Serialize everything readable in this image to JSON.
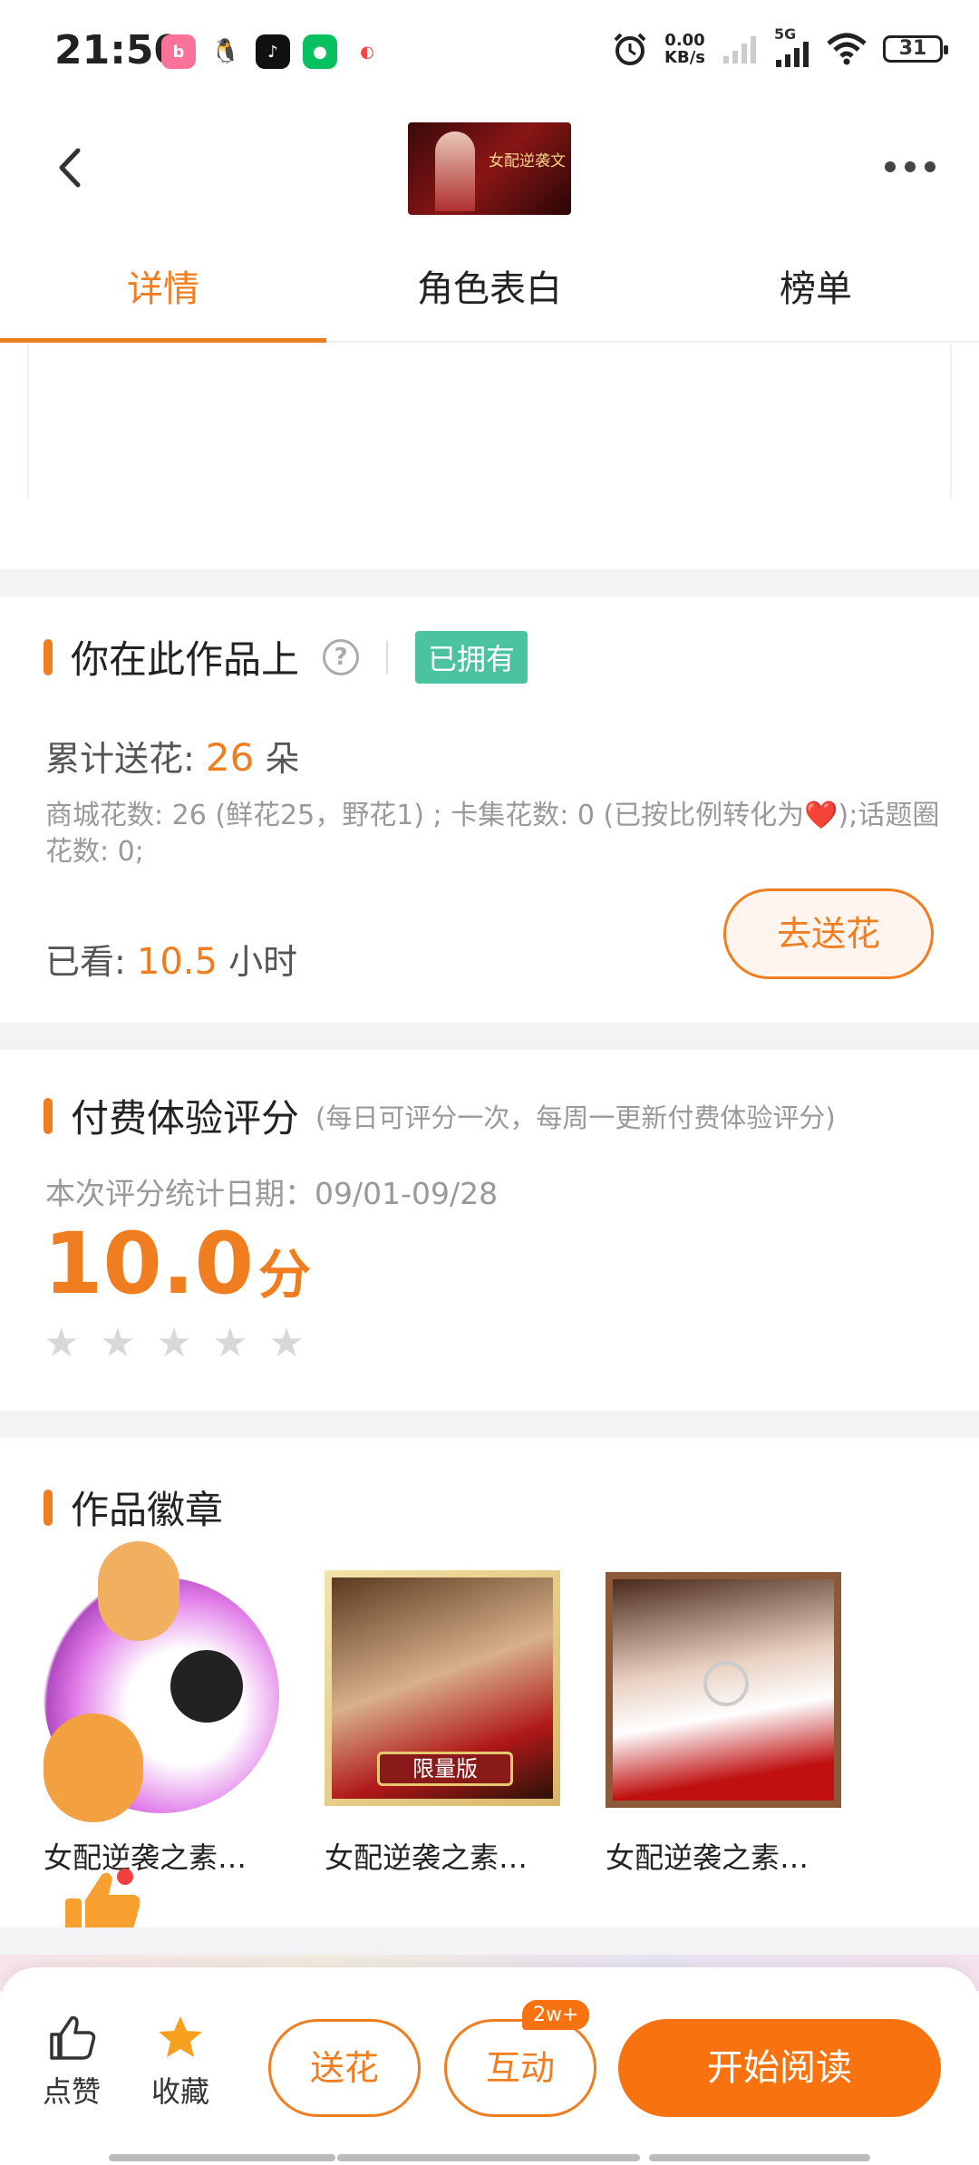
{
  "status_bar": {
    "time": "21:50",
    "net_speed_value": "0.00",
    "net_speed_unit": "KB/s",
    "signal_label": "5G",
    "battery": "31"
  },
  "nav": {
    "cover_title": "女配逆袭文"
  },
  "tabs": [
    {
      "label": "详情",
      "active": true
    },
    {
      "label": "角色表白",
      "active": false
    },
    {
      "label": "榜单",
      "active": false
    }
  ],
  "ownership": {
    "title": "你在此作品上",
    "help_symbol": "?",
    "owned_badge": "已拥有",
    "flowers_label": "累计送花:",
    "flowers_value": "26",
    "flowers_unit": "朵",
    "flowers_detail": "商城花数: 26 (鲜花25，野花1) ; 卡集花数: 0 (已按比例转化为❤️);话题圈花数: 0;",
    "watched_label": "已看:",
    "watched_value": "10.5",
    "watched_unit": "小时",
    "send_flower_button": "去送花"
  },
  "rating": {
    "title": "付费体验评分",
    "note": "(每日可评分一次，每周一更新付费体验评分)",
    "period": "本次评分统计日期：09/01-09/28",
    "score": "10.0",
    "score_unit": "分",
    "stars_filled": 0,
    "stars_total": 5
  },
  "badges": {
    "title": "作品徽章",
    "items": [
      {
        "label": "女配逆袭之素…"
      },
      {
        "label": "女配逆袭之素…",
        "tag": "限量版"
      },
      {
        "label": "女配逆袭之素…"
      }
    ]
  },
  "bottom_bar": {
    "like_label": "点赞",
    "favorite_label": "收藏",
    "send_flower_label": "送花",
    "interact_label": "互动",
    "interact_badge": "2w+",
    "start_reading_label": "开始阅读"
  },
  "colors": {
    "accent": "#f07d20",
    "owned_badge": "#4cc3a0",
    "primary_button": "#f8730f"
  }
}
